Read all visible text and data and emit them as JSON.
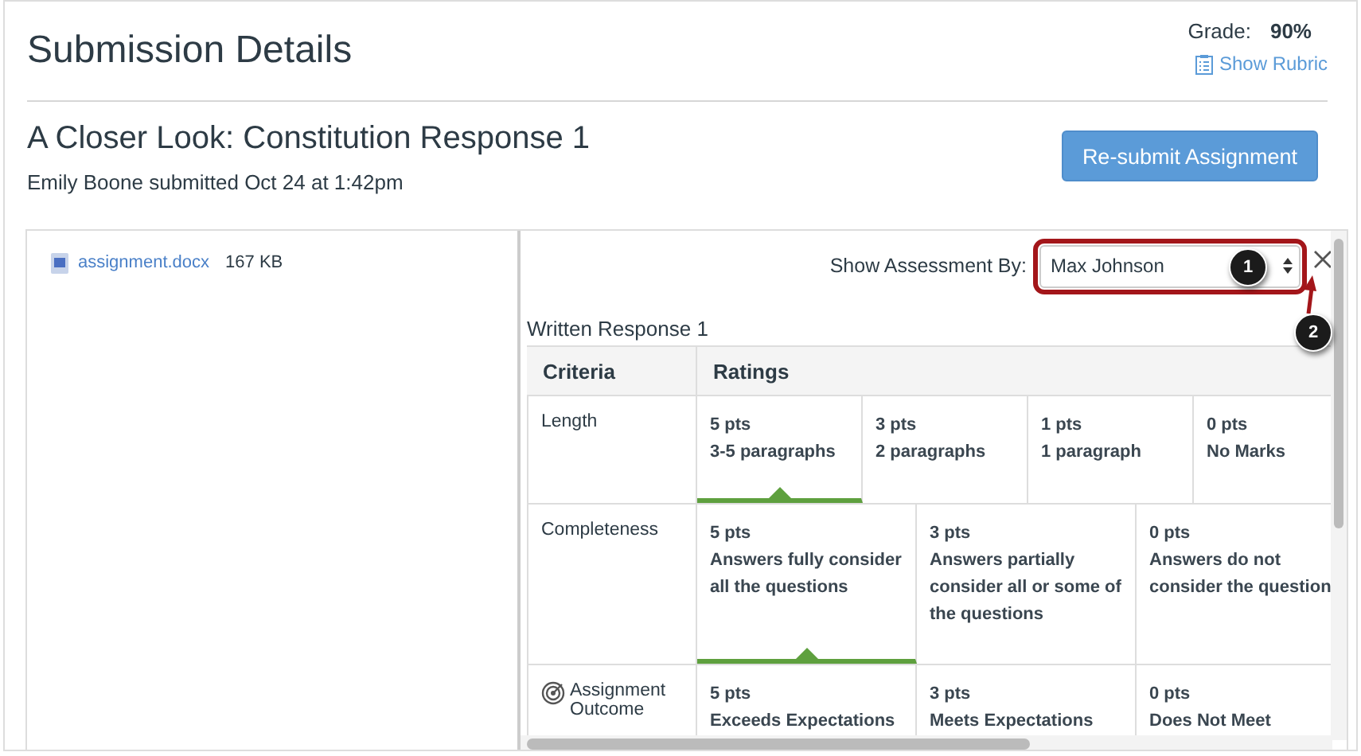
{
  "header": {
    "title": "Submission Details",
    "grade_label": "Grade:",
    "grade": "90%",
    "rubric_link": "Show Rubric"
  },
  "assignment": {
    "title": "A Closer Look: Constitution Response 1",
    "submitted": "Emily Boone submitted Oct 24 at 1:42pm",
    "button": "Re-submit Assignment"
  },
  "file": {
    "name": "assignment.docx",
    "size": "167 KB"
  },
  "assessment": {
    "label": "Show Assessment By:",
    "value": "Max Johnson"
  },
  "callouts": [
    "1",
    "2"
  ],
  "rubric": {
    "title": "Written Response 1",
    "columns": [
      "Criteria",
      "Ratings"
    ],
    "rows": [
      {
        "kind": "criterion",
        "criterion": "Length",
        "ratings": [
          {
            "points": "5 pts",
            "description": "3-5 paragraphs",
            "selected": true
          },
          {
            "points": "3 pts",
            "description": "2 paragraphs",
            "selected": false
          },
          {
            "points": "1 pts",
            "description": "1 paragraph",
            "selected": false
          },
          {
            "points": "0 pts",
            "description": "No Marks",
            "selected": false
          }
        ]
      },
      {
        "kind": "criterion",
        "criterion": "Completeness",
        "ratings": [
          {
            "points": "5 pts",
            "description": "Answers fully consider all the questions",
            "selected": true
          },
          {
            "points": "3 pts",
            "description": "Answers partially consider all or some of the questions",
            "selected": false
          },
          {
            "points": "0 pts",
            "description": "Answers do not consider the question",
            "selected": false
          }
        ]
      },
      {
        "kind": "outcome",
        "criterion": "Assignment Outcome",
        "ratings": [
          {
            "points": "5 pts",
            "description": "Exceeds Expectations"
          },
          {
            "points": "3 pts",
            "description": "Meets Expectations"
          },
          {
            "points": "0 pts",
            "description": "Does Not Meet"
          }
        ]
      }
    ]
  }
}
